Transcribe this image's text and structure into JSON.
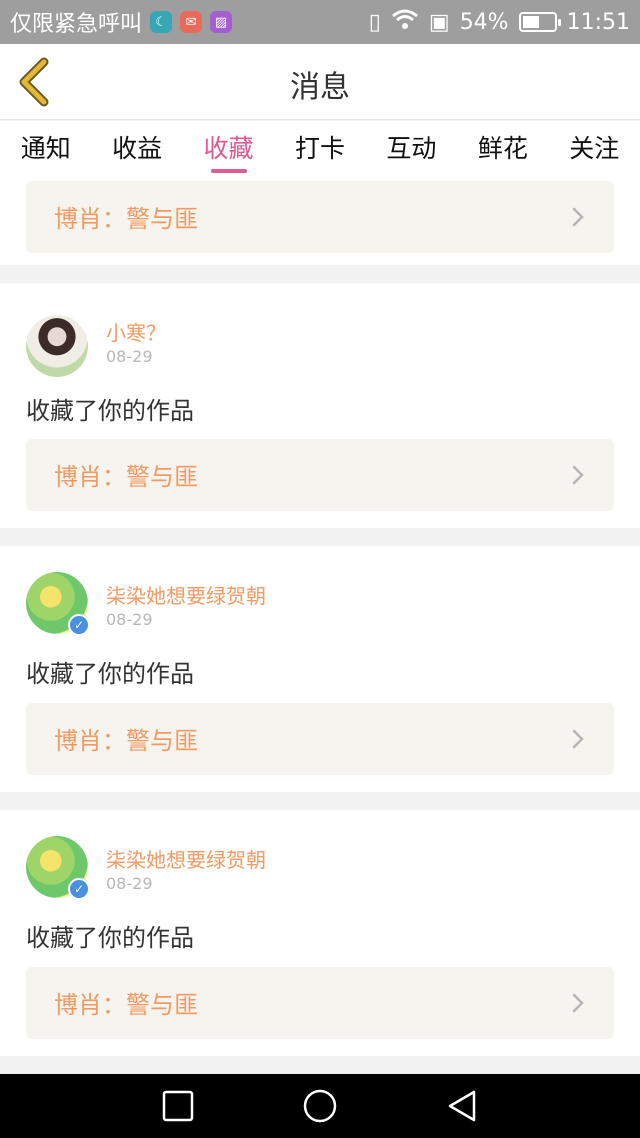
{
  "status_bar": {
    "carrier": "仅限紧急呼叫",
    "battery_percent": "54%",
    "battery_level": 0.54,
    "time": "11:51",
    "icons": [
      "moon-app-icon",
      "mail-app-icon",
      "gallery-app-icon",
      "vibrate-icon",
      "wifi-icon",
      "sim-icon",
      "battery-icon"
    ]
  },
  "header": {
    "title": "消息"
  },
  "tabs": [
    {
      "label": "通知"
    },
    {
      "label": "收益"
    },
    {
      "label": "收藏"
    },
    {
      "label": "打卡"
    },
    {
      "label": "互动"
    },
    {
      "label": "鲜花"
    },
    {
      "label": "关注"
    }
  ],
  "active_tab": "收藏",
  "partial_card": {
    "work_title": "博肖：警与匪"
  },
  "cards": [
    {
      "username": "小寒？",
      "date": "08-29",
      "action": "收藏了你的作品",
      "work_title": "博肖：警与匪",
      "verified": false
    },
    {
      "username": "柒染她想要绿贺朝",
      "date": "08-29",
      "action": "收藏了你的作品",
      "work_title": "博肖：警与匪",
      "verified": true
    },
    {
      "username": "柒染她想要绿贺朝",
      "date": "08-29",
      "action": "收藏了你的作品",
      "work_title": "博肖：警与匪",
      "verified": true
    }
  ],
  "colors": {
    "accent": "#e05a92",
    "username": "#f29a63",
    "work_title": "#f29a63",
    "back_icon": "#e2b73a"
  }
}
